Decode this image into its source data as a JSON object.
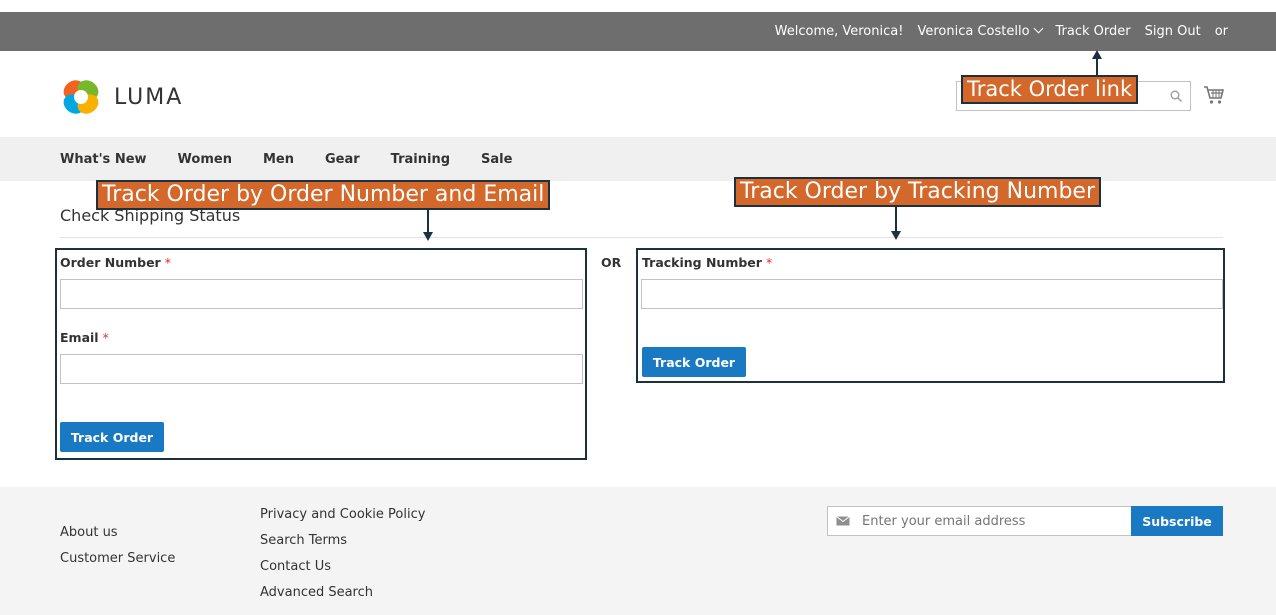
{
  "topbar": {
    "welcome": "Welcome, Veronica!",
    "account_name": "Veronica Costello",
    "track_order": "Track Order",
    "sign_out": "Sign Out",
    "or": "or"
  },
  "header": {
    "logo_text": "LUMA",
    "search_placeholder": ""
  },
  "nav": {
    "items": [
      "What's New",
      "Women",
      "Men",
      "Gear",
      "Training",
      "Sale"
    ]
  },
  "main": {
    "page_title": "Check Shipping Status",
    "order_form": {
      "order_number_label": "Order Number",
      "order_number_value": "",
      "email_label": "Email",
      "email_value": "",
      "required_mark": "*",
      "submit_label": "Track Order"
    },
    "or_label": "OR",
    "tracking_form": {
      "tracking_number_label": "Tracking Number",
      "tracking_number_value": "",
      "required_mark": "*",
      "submit_label": "Track Order"
    }
  },
  "annotations": {
    "track_order_link": "Track Order link",
    "order_number_email": "Track Order by Order Number and Email",
    "tracking_number": "Track Order by Tracking Number"
  },
  "footer": {
    "col1": [
      "About us",
      "Customer Service"
    ],
    "col2": [
      "Privacy and Cookie Policy",
      "Search Terms",
      "Contact Us",
      "Advanced Search"
    ],
    "newsletter_placeholder": "Enter your email address",
    "subscribe_label": "Subscribe"
  },
  "colors": {
    "topbar_bg": "#6e6e6e",
    "nav_bg": "#f0f0f0",
    "primary_button": "#1979c3",
    "annotation_bg": "#d4672a",
    "annotation_border": "#1b3140",
    "required": "#e02b27",
    "footer_bg": "#f4f4f4"
  },
  "icons": {
    "logo": "luma-logo-icon",
    "search": "search-icon",
    "cart": "cart-icon",
    "account_dropdown": "chevron-down-icon",
    "newsletter": "mail-icon"
  }
}
